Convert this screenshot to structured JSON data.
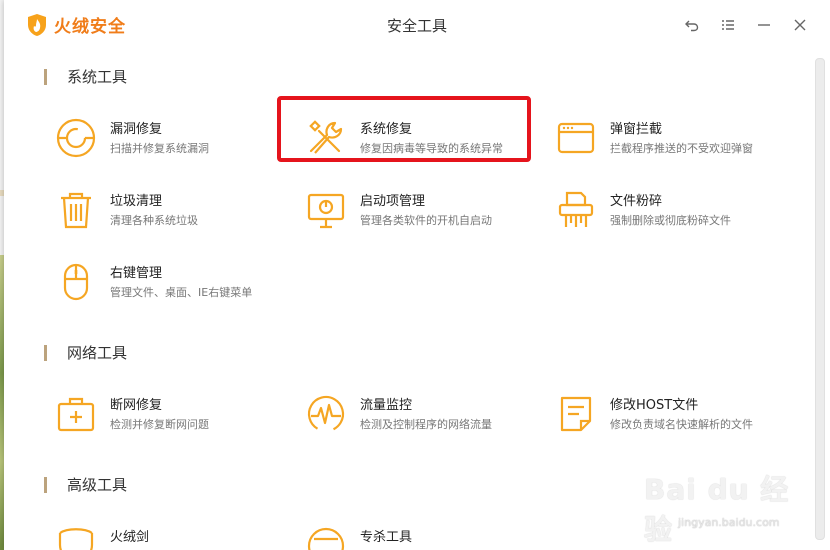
{
  "app": {
    "brand": "火绒安全",
    "window_title": "安全工具"
  },
  "window_controls": [
    {
      "name": "back-icon"
    },
    {
      "name": "menu-icon"
    },
    {
      "name": "minimize-icon"
    },
    {
      "name": "close-icon"
    }
  ],
  "sections": {
    "system": {
      "title": "系统工具",
      "items": [
        {
          "name": "漏洞修复",
          "desc": "扫描并修复系统漏洞",
          "icon": "vulnerability-repair-icon"
        },
        {
          "name": "系统修复",
          "desc": "修复因病毒等导致的系统异常",
          "icon": "wrench-screwdriver-icon"
        },
        {
          "name": "弹窗拦截",
          "desc": "拦截程序推送的不受欢迎弹窗",
          "icon": "popup-window-icon"
        },
        {
          "name": "垃圾清理",
          "desc": "清理各种系统垃圾",
          "icon": "trash-icon"
        },
        {
          "name": "启动项管理",
          "desc": "管理各类软件的开机自启动",
          "icon": "monitor-startup-icon"
        },
        {
          "name": "文件粉碎",
          "desc": "强制删除或彻底粉碎文件",
          "icon": "file-shredder-icon"
        },
        {
          "name": "右键管理",
          "desc": "管理文件、桌面、IE右键菜单",
          "icon": "mouse-icon"
        }
      ]
    },
    "network": {
      "title": "网络工具",
      "items": [
        {
          "name": "断网修复",
          "desc": "检测并修复断网问题",
          "icon": "medical-kit-icon"
        },
        {
          "name": "流量监控",
          "desc": "检测及控制程序的网络流量",
          "icon": "traffic-gauge-icon"
        },
        {
          "name": "修改HOST文件",
          "desc": "修改负责域名快速解析的文件",
          "icon": "document-edit-icon"
        }
      ]
    },
    "advanced": {
      "title": "高级工具",
      "items": [
        {
          "name": "火绒剑",
          "icon": "sword-shield-icon"
        },
        {
          "name": "专杀工具",
          "icon": "kill-tool-icon"
        }
      ]
    }
  },
  "watermark": {
    "main": "Bai du 经验",
    "sub": "jingyan.baidu.com"
  },
  "colors": {
    "accent": "#f5a623",
    "brand": "#f07d1a",
    "highlight": "#e5141c"
  }
}
